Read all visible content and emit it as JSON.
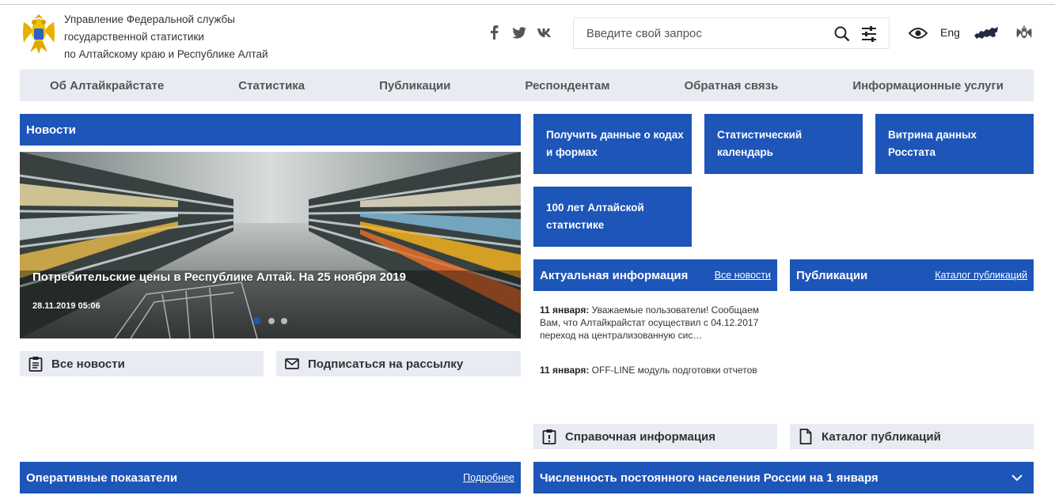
{
  "header": {
    "org_line1": "Управление Федеральной службы",
    "org_line2": "государственной статистики",
    "org_line3": "по Алтайскому краю и Республике Алтай",
    "social": [
      "facebook-icon",
      "twitter-icon",
      "vk-icon"
    ],
    "search_placeholder": "Введите свой запрос",
    "lang": "Eng"
  },
  "nav": {
    "items": [
      "Об Алтайкрайстате",
      "Статистика",
      "Публикации",
      "Респондентам",
      "Обратная связь",
      "Информационные услуги"
    ]
  },
  "news": {
    "header": "Новости",
    "slide_title": "Потребительские цены в Республике Алтай. На 25 ноября 2019",
    "slide_date": "28.11.2019 05:06",
    "all_news": "Все новости",
    "subscribe": "Подписаться на рассылку"
  },
  "tiles": [
    "Получить данные о кодах и формах",
    "Статистический календарь",
    "Витрина данных Росстата",
    "100 лет Алтайской статистике"
  ],
  "actual": {
    "header": "Актуальная информация",
    "link": "Все новости",
    "items": [
      {
        "date": "11 января:",
        "text": " Уважаемые пользователи! Сообщаем Вам, что Алтайкрайстат осуществил с 04.12.2017 переход на централизованную сис…"
      },
      {
        "date": "11 января:",
        "text": " OFF-LINE модуль подготовки отчетов"
      }
    ],
    "reference": "Справочная информация"
  },
  "publications": {
    "header": "Публикации",
    "link": "Каталог публикаций",
    "catalog": "Каталог публикаций"
  },
  "indicators": {
    "header": "Оперативные показатели",
    "link": "Подробнее"
  },
  "population": {
    "header": "Численность постоянного населения России на 1 января"
  },
  "colors": {
    "accent": "#1d55b8",
    "grey_bg": "#e8ebf2"
  }
}
